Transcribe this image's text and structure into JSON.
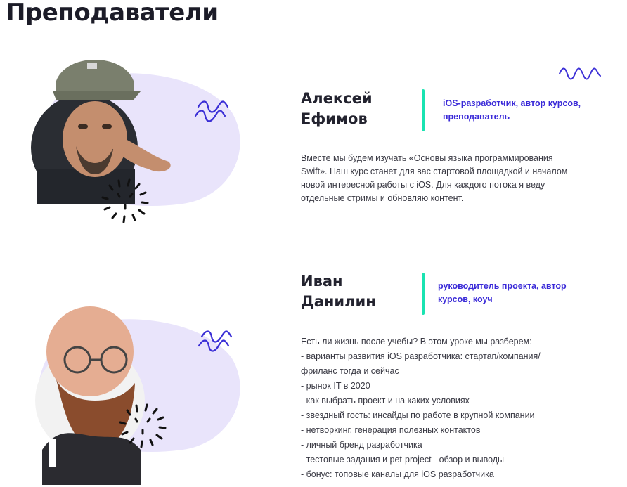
{
  "page": {
    "title": "Преподаватели"
  },
  "teachers": [
    {
      "name": "Алексей Ефимов",
      "role": "iOS-разработчик, автор курсов, преподаватель",
      "description": "Вместе мы будем изучать «Основы языка программирования Swift». Наш курс станет для вас стартовой площадкой и началом новой интересной работы с iOS. Для каждого потока я веду отдельные стримы и обновляю контент."
    },
    {
      "name": "Иван Данилин",
      "role": "руководитель проекта, автор курсов, коуч",
      "intro": "Есть ли жизнь после учебы? В этом уроке мы разберем:",
      "topics": [
        "- варианты развития iOS разработчика: стартап/компания/",
        "фриланс тогда и сейчас",
        "- рынок IT в 2020",
        "- как выбрать проект и на каких условиях",
        "- звездный гость: инсайды по работе в крупной компании",
        "- нетворкинг, генерация полезных контактов",
        "- личный бренд разработчика",
        "- тестовые задания и pet-project - обзор и выводы",
        "- бонус: топовые каналы для iOS разработчика"
      ]
    }
  ],
  "colors": {
    "accent_bar": "#19e3b1",
    "role_text": "#3a2ad8",
    "blob": "#e9e4fb",
    "squiggle": "#3b2fd6"
  },
  "icons": [
    "wave-icon",
    "squiggle-icon",
    "dots-burst-icon"
  ]
}
